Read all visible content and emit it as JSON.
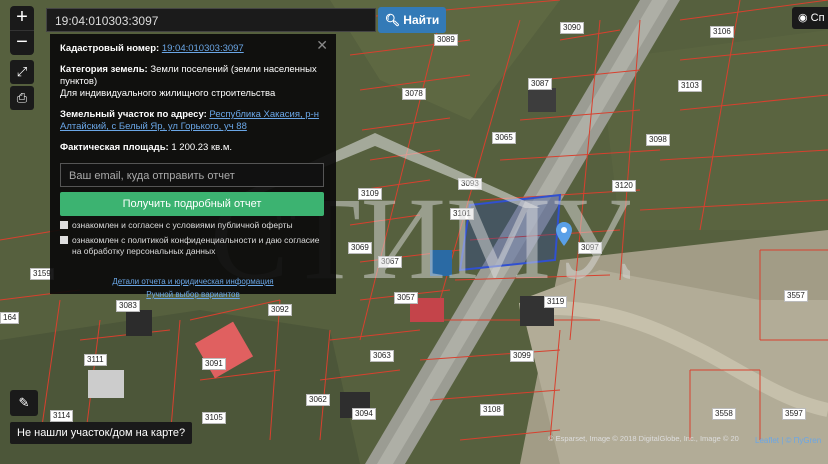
{
  "search": {
    "value": "19:04:010303:3097",
    "button_label": "Найти",
    "layers_label": "Сп"
  },
  "popup": {
    "cadastral_label": "Кадастровый номер:",
    "cadastral_value": "19:04:010303:3097",
    "category_label": "Категория земель:",
    "category_value": "Земли поселений (земли населенных пунктов)",
    "purpose_value": "Для индивидуального жилищного строительства",
    "address_label": "Земельный участок по адресу:",
    "address_value": "Республика Хакасия, р-н Алтайский, с Белый Яр, ул Горького, уч 88",
    "area_label": "Фактическая площадь:",
    "area_value": "1 200.23 кв.м.",
    "email_placeholder": "Ваш email, куда отправить отчет",
    "submit_label": "Получить подробный отчет",
    "check1_text": "ознакомлен и согласен с условиями публичной оферты",
    "check2_text": "ознакомлен с политикой конфиденциальности и даю согласие на обработку персональных данных",
    "details_link": "Детали отчета и юридическая информация",
    "manual_link": "Ручной выбор вариантов"
  },
  "watermark": {
    "text": "СТИМУЛ"
  },
  "parcels": [
    "3089",
    "3090",
    "3106",
    "3078",
    "3087",
    "3103",
    "3065",
    "3098",
    "3093",
    "3109",
    "3120",
    "3101",
    "3097",
    "3092",
    "3057",
    "3119",
    "3083",
    "3067",
    "3099",
    "3091",
    "3063",
    "3111",
    "3062",
    "3094",
    "3114",
    "3108",
    "3105",
    "3557",
    "3558",
    "3597",
    "3159",
    "3069",
    "164",
    "3120"
  ],
  "bottom": {
    "not_found_label": "Не нашли участок/дом на карте?"
  },
  "attribution": {
    "text": "© Esparset, Image © 2018 DigitalGlobe, Inc., Image © 20",
    "leaflet": "Leaflet | © ПуGren"
  }
}
